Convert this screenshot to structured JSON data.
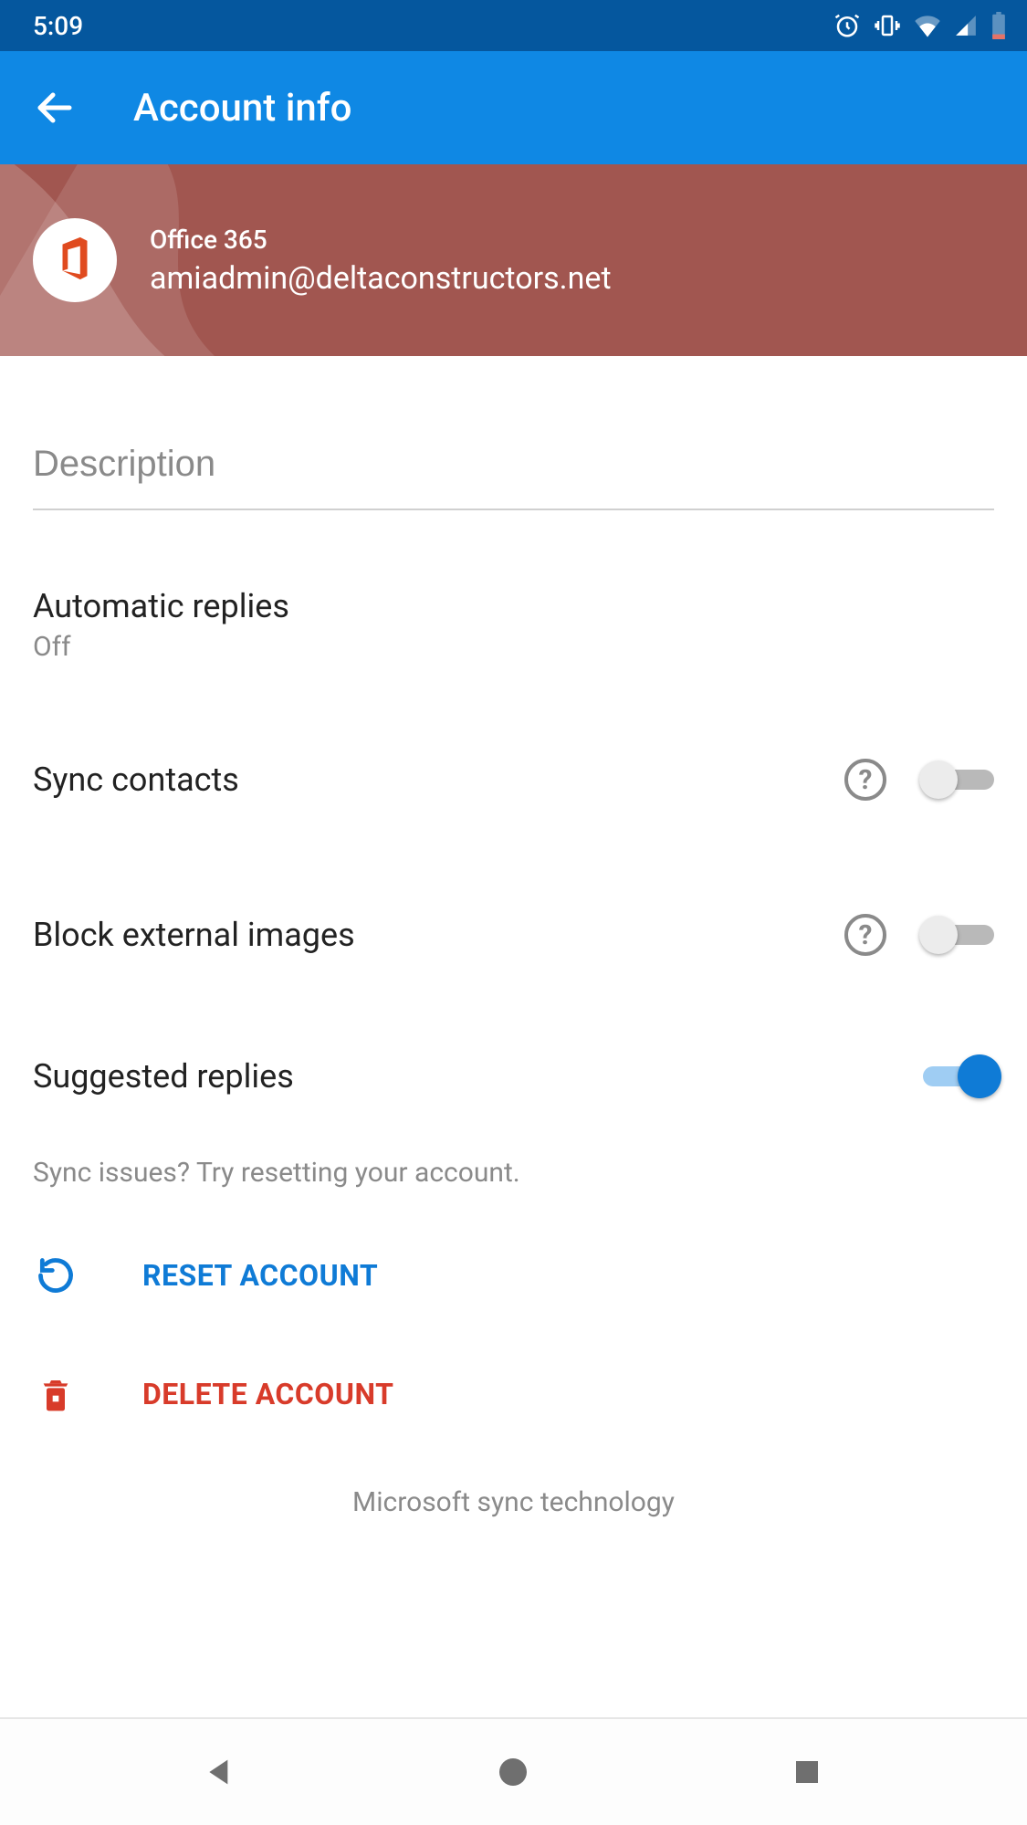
{
  "status": {
    "time": "5:09"
  },
  "appbar": {
    "title": "Account info"
  },
  "account": {
    "type": "Office 365",
    "email": "amiadmin@deltaconstructors.net"
  },
  "description": {
    "placeholder": "Description",
    "value": ""
  },
  "settings": {
    "automatic_replies": {
      "label": "Automatic replies",
      "value": "Off"
    },
    "sync_contacts": {
      "label": "Sync contacts",
      "on": false
    },
    "block_external_images": {
      "label": "Block external images",
      "on": false
    },
    "suggested_replies": {
      "label": "Suggested replies",
      "on": true
    }
  },
  "hint": "Sync issues? Try resetting your account.",
  "actions": {
    "reset": "RESET ACCOUNT",
    "delete": "DELETE ACCOUNT"
  },
  "footer": "Microsoft sync technology",
  "colors": {
    "status_bar": "#05579E",
    "app_bar": "#0F88E4",
    "account_header": "#A15650",
    "accent": "#0F7BD6",
    "danger": "#D83B2A"
  }
}
